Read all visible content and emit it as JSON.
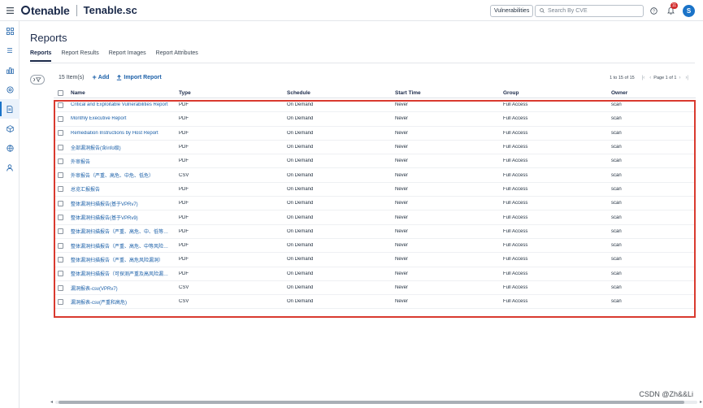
{
  "app": {
    "brand": "tenable",
    "product": "Tenable.sc"
  },
  "topbar": {
    "scope": "Vulnerabilities",
    "search_placeholder": "Search By CVE",
    "notifications_count": "11",
    "avatar_initial": "S"
  },
  "page": {
    "title": "Reports",
    "tabs": [
      {
        "label": "Reports",
        "active": true
      },
      {
        "label": "Report Results",
        "active": false
      },
      {
        "label": "Report Images",
        "active": false
      },
      {
        "label": "Report Attributes",
        "active": false
      }
    ]
  },
  "toolbar": {
    "items_count": "15 Item(s)",
    "add_label": "Add",
    "import_label": "Import Report",
    "range_label": "1 to 15 of 15",
    "page_label": "Page 1 of 1"
  },
  "table": {
    "headers": {
      "name": "Name",
      "type": "Type",
      "schedule": "Schedule",
      "start_time": "Start Time",
      "group": "Group",
      "owner": "Owner"
    },
    "rows": [
      {
        "name": "Critical and Exploitable Vulnerabilities Report",
        "type": "PDF",
        "schedule": "On Demand",
        "start": "Never",
        "group": "Full Access",
        "owner": "scan"
      },
      {
        "name": "Monthly Executive Report",
        "type": "PDF",
        "schedule": "On Demand",
        "start": "Never",
        "group": "Full Access",
        "owner": "scan"
      },
      {
        "name": "Remediation Instructions by Host Report",
        "type": "PDF",
        "schedule": "On Demand",
        "start": "Never",
        "group": "Full Access",
        "owner": "scan"
      },
      {
        "name": "全部漏洞报告(含info级)",
        "type": "PDF",
        "schedule": "On Demand",
        "start": "Never",
        "group": "Full Access",
        "owner": "scan"
      },
      {
        "name": "外审报告",
        "type": "PDF",
        "schedule": "On Demand",
        "start": "Never",
        "group": "Full Access",
        "owner": "scan"
      },
      {
        "name": "外审报告（严重、高危、中危、低危）",
        "type": "CSV",
        "schedule": "On Demand",
        "start": "Never",
        "group": "Full Access",
        "owner": "scan"
      },
      {
        "name": "总览汇报报告",
        "type": "PDF",
        "schedule": "On Demand",
        "start": "Never",
        "group": "Full Access",
        "owner": "scan"
      },
      {
        "name": "整体漏洞扫描报告(基于VPRv7)",
        "type": "PDF",
        "schedule": "On Demand",
        "start": "Never",
        "group": "Full Access",
        "owner": "scan"
      },
      {
        "name": "整体漏洞扫描报告(基于VPRv9)",
        "type": "PDF",
        "schedule": "On Demand",
        "start": "Never",
        "group": "Full Access",
        "owner": "scan"
      },
      {
        "name": "整体漏洞扫描报告（严重、高危、中、低等…",
        "type": "PDF",
        "schedule": "On Demand",
        "start": "Never",
        "group": "Full Access",
        "owner": "scan"
      },
      {
        "name": "整体漏洞扫描报告（严重、高危、中等风险…",
        "type": "PDF",
        "schedule": "On Demand",
        "start": "Never",
        "group": "Full Access",
        "owner": "scan"
      },
      {
        "name": "整体漏洞扫描报告（严重、高危风险漏洞）",
        "type": "PDF",
        "schedule": "On Demand",
        "start": "Never",
        "group": "Full Access",
        "owner": "scan"
      },
      {
        "name": "整体漏洞扫描报告（可探测严重及高风险漏…",
        "type": "PDF",
        "schedule": "On Demand",
        "start": "Never",
        "group": "Full Access",
        "owner": "scan"
      },
      {
        "name": "漏洞报表-csv(VPRv7)",
        "type": "CSV",
        "schedule": "On Demand",
        "start": "Never",
        "group": "Full Access",
        "owner": "scan"
      },
      {
        "name": "漏洞报表-csv(严重和高危)",
        "type": "CSV",
        "schedule": "On Demand",
        "start": "Never",
        "group": "Full Access",
        "owner": "scan"
      }
    ]
  },
  "watermark": "CSDN @Zh&&Li",
  "colors": {
    "accent": "#1a73c8",
    "link": "#1a5fa8",
    "highlight": "#d93a2f",
    "brand": "#1b2a4a"
  }
}
